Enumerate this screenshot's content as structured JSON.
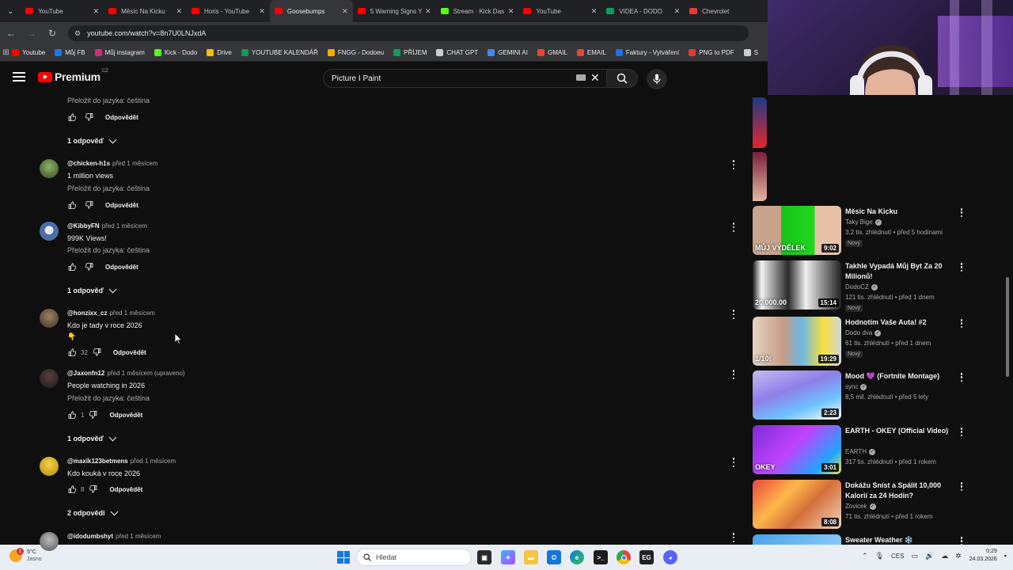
{
  "browser": {
    "tabs": [
      {
        "title": "YouTube",
        "color": "#ff0000",
        "active": false
      },
      {
        "title": "Měsíc Na Kicku",
        "color": "#ff0000",
        "active": false
      },
      {
        "title": "Horis - YouTube",
        "color": "#ff0000",
        "active": false
      },
      {
        "title": "Goosebumps",
        "color": "#ff0000",
        "active": true
      },
      {
        "title": "5 Warning Signs Y",
        "color": "#ff0000",
        "active": false
      },
      {
        "title": "Stream · Kick Das",
        "color": "#53fc18",
        "active": false
      },
      {
        "title": "YouTube",
        "color": "#ff0000",
        "active": false
      },
      {
        "title": "VIDEA - DODO",
        "color": "#0f9d58",
        "active": false
      },
      {
        "title": "Chevrolet",
        "color": "#e53935",
        "active": false
      }
    ],
    "url": "youtube.com/watch?v=8n7U0LNJxdA",
    "bookmarks": [
      {
        "label": "Youtube",
        "color": "#ff0000"
      },
      {
        "label": "Můj FB",
        "color": "#1877f2"
      },
      {
        "label": "Můj instagram",
        "color": "#d62976"
      },
      {
        "label": "Kick - Dodo",
        "color": "#53fc18"
      },
      {
        "label": "Drive",
        "color": "#fbbc04"
      },
      {
        "label": "YOUTUBE KALENDÁŘ",
        "color": "#0f9d58"
      },
      {
        "label": "FNGG - Dodoeu",
        "color": "#f9ab00"
      },
      {
        "label": "PŘÍJEM",
        "color": "#0f9d58"
      },
      {
        "label": "CHAT GPT",
        "color": "#cccccc"
      },
      {
        "label": "GEMINI AI",
        "color": "#4285f4"
      },
      {
        "label": "GMAIL",
        "color": "#ea4335"
      },
      {
        "label": "EMAIL",
        "color": "#ea4335"
      },
      {
        "label": "Faktury - Vytváření",
        "color": "#1a73e8"
      },
      {
        "label": "PNG to PDF",
        "color": "#e53935"
      },
      {
        "label": "S",
        "color": "#cccccc"
      }
    ]
  },
  "youtube": {
    "brand": "Premium",
    "country": "CZ",
    "search_query": "Picture I Paint"
  },
  "comments": {
    "top_partial": {
      "translate": "Přeložit do jazyka: čeština",
      "reply": "Odpovědět",
      "replies": "1 odpověď"
    },
    "items": [
      {
        "author": "@chicken-h1s",
        "time": "před 1 měsícem",
        "text": "1 million views",
        "translate": "Přeložit do jazyka: čeština",
        "likes": "",
        "reply": "Odpovědět",
        "replies": ""
      },
      {
        "author": "@KibbyFN",
        "time": "před 1 měsícem",
        "text": "999K Views!",
        "translate": "Přeložit do jazyka: čeština",
        "likes": "",
        "reply": "Odpovědět",
        "replies": "1 odpověď"
      },
      {
        "author": "@honzixx_cz",
        "time": "před 1 měsícem",
        "text": "Kdo je tady v roce 2026",
        "emoji": "👇",
        "likes": "32",
        "reply": "Odpovědět",
        "replies": ""
      },
      {
        "author": "@Jaxonfn12",
        "time": "před 1 měsícem (upraveno)",
        "text": "People watching in 2026",
        "translate": "Přeložit do jazyka: čeština",
        "likes": "1",
        "reply": "Odpovědět",
        "replies": "1 odpověď"
      },
      {
        "author": "@maxik123betmens",
        "time": "před 1 měsícem",
        "text": "Kdo kouká v roce 2026",
        "likes": "8",
        "reply": "Odpovědět",
        "replies": "2 odpovědi"
      },
      {
        "author": "@idodumbshyt",
        "time": "před 1 měsícem"
      }
    ]
  },
  "sidebar": {
    "videos": [
      {
        "title": "Měsíc Na Kicku",
        "channel": "Taky Bige",
        "meta": "3,2 tis. zhlédnutí • před 5 hodinami",
        "badge": "Nový",
        "duration": "9:02",
        "thumb_text": "MŮJ VÝDĚLEK"
      },
      {
        "title": "Takhle Vypadá Můj Byt Za 20 Milionů!",
        "channel": "DodoCZ",
        "meta": "121 tis. zhlédnutí • před 1 dnem",
        "badge": "Nový",
        "duration": "15:14",
        "thumb_text": "20.000.00"
      },
      {
        "title": "Hodnotím Vaše Auta! #2",
        "channel": "Dodo dva",
        "meta": "61 tis. zhlédnutí • před 1 dnem",
        "badge": "Nový",
        "duration": "19:29",
        "thumb_text": "1/10!"
      },
      {
        "title": "Mood 💜 (Fortnite Montage)",
        "channel": "sync",
        "meta": "8,5 mil. zhlédnutí • před 5 lety",
        "badge": "",
        "duration": "2:23",
        "thumb_text": ""
      },
      {
        "title": "EARTH - OKEY (Official Video)",
        "channel": "EARTH",
        "meta": "317 tis. zhlédnutí • před 1 rokem",
        "badge": "",
        "duration": "3:01",
        "thumb_text": "OKEY"
      },
      {
        "title": "Dokážu Sníst a Spálit 10,000 Kalorií za 24 Hodin?",
        "channel": "Zovicek",
        "meta": "71 tis. zhlédnutí • před 1 rokem",
        "badge": "",
        "duration": "8:08",
        "thumb_text": ""
      },
      {
        "title": "Sweater Weather ❄️",
        "channel": "",
        "meta": "",
        "badge": "",
        "duration": "",
        "thumb_text": ""
      }
    ]
  },
  "taskbar": {
    "weather_temp": "5°C",
    "weather_desc": "Jasno",
    "weather_alert": "1",
    "search_placeholder": "Hledat",
    "language": "CES",
    "time": "0:29",
    "date": "24.03.2026"
  }
}
